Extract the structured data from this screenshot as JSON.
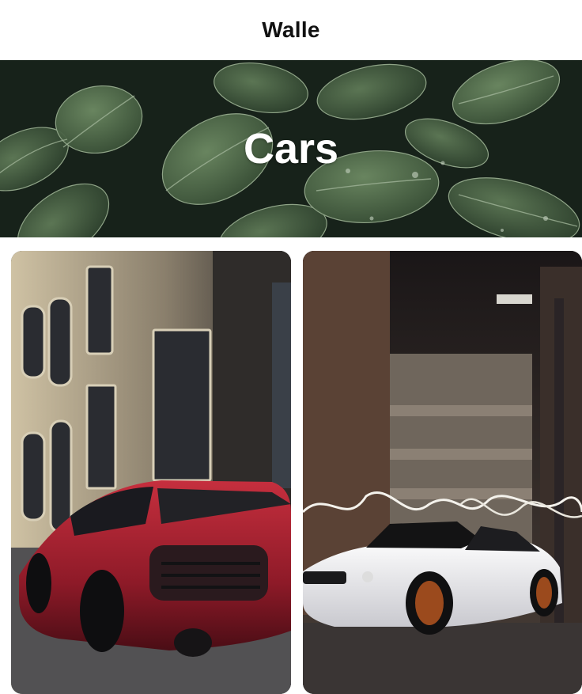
{
  "header": {
    "title": "Walle"
  },
  "hero": {
    "title": "Cars",
    "background": "green-leaves-image"
  },
  "gallery": {
    "items": [
      {
        "image": "red-sports-car-image"
      },
      {
        "image": "white-muscle-car-image"
      }
    ]
  },
  "colors": {
    "header_bg": "#ffffff",
    "title_text": "#111111",
    "hero_text": "#ffffff"
  }
}
